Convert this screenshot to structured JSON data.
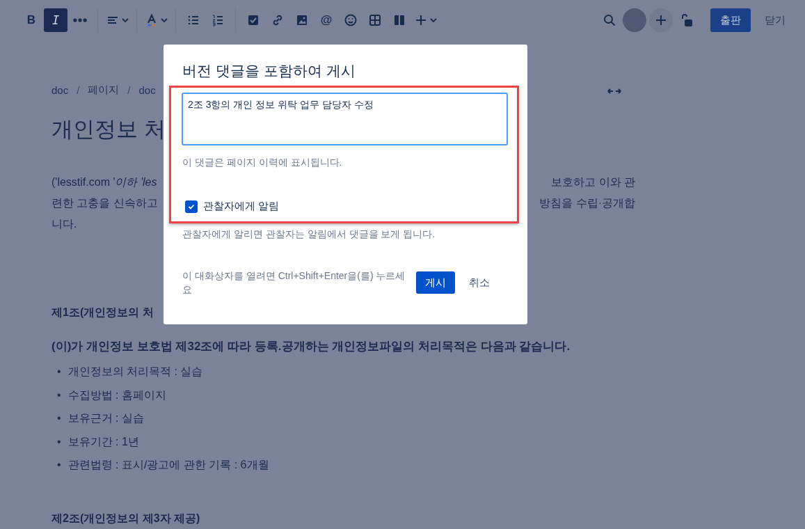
{
  "toolbar": {
    "groups": [
      {
        "items": [
          {
            "kind": "bold",
            "label": "B",
            "selected": false,
            "dropdown": false
          },
          {
            "kind": "italic",
            "label": "I",
            "selected": true,
            "dropdown": false
          },
          {
            "kind": "more",
            "selected": false,
            "dropdown": false
          }
        ]
      },
      {
        "items": [
          {
            "kind": "align",
            "selected": false,
            "dropdown": true
          }
        ]
      },
      {
        "items": [
          {
            "kind": "text-color",
            "selected": false,
            "dropdown": true
          }
        ]
      },
      {
        "items": [
          {
            "kind": "bullet-list",
            "selected": false,
            "dropdown": false
          },
          {
            "kind": "numbered-list",
            "selected": false,
            "dropdown": false
          }
        ]
      },
      {
        "items": [
          {
            "kind": "task",
            "selected": false,
            "dropdown": false
          },
          {
            "kind": "link",
            "selected": false,
            "dropdown": false
          },
          {
            "kind": "image",
            "selected": false,
            "dropdown": false
          },
          {
            "kind": "mention",
            "label": "@",
            "selected": false,
            "dropdown": false
          },
          {
            "kind": "emoji",
            "selected": false,
            "dropdown": false
          },
          {
            "kind": "table",
            "selected": false,
            "dropdown": false
          },
          {
            "kind": "layout",
            "selected": false,
            "dropdown": false
          },
          {
            "kind": "insert",
            "selected": false,
            "dropdown": true
          }
        ]
      }
    ],
    "publish_button": "출판",
    "close_button": "닫기"
  },
  "breadcrumbs": [
    {
      "kind": "link",
      "text": "doc"
    },
    {
      "kind": "separator",
      "text": "/"
    },
    {
      "kind": "link",
      "text": "페이지"
    },
    {
      "kind": "separator",
      "text": "/"
    },
    {
      "kind": "link",
      "text": "doc"
    }
  ],
  "page_title": "개인정보 처",
  "intro_lines": [
    {
      "left": "('lesstif.com '*이하 'les*",
      "right": "보호하고 이와 관"
    },
    {
      "left": "련한 고충을 신속하고",
      "right": "방침을 수립·공개합"
    },
    {
      "left": "니다."
    }
  ],
  "section_1_heading": "제1조(개인정보의 처",
  "section_1_text": "(이)가 개인정보 보호법 제32조에 따라 등록.공개하는 개인정보파일의 처리목적은 다음과 같습니다.",
  "section_1_list": [
    {
      "bullet": "•",
      "text": "개인정보의 처리목적 : 실습"
    },
    {
      "bullet": "•",
      "text": "수집방법 : 홈페이지"
    },
    {
      "bullet": "•",
      "text": "보유근거 : 실습"
    },
    {
      "bullet": "•",
      "text": "보유기간 : 1년"
    },
    {
      "bullet": "•",
      "text": "관련법령 : 표시/광고에 관한 기록 : 6개월"
    }
  ],
  "section_2_heading": "제2조(개인정보의 제3자 제공)",
  "dialog": {
    "title": "버전 댓글을 포함하여 게시",
    "comment_value": "2조 3항의 개인 정보 위탁 업무 담당자 수정",
    "comment_hint": "이 댓글은 페이지 이력에 표시됩니다.",
    "notify_label": "관찰자에게 알림",
    "notify_checked": true,
    "notify_description": "관찰자에게 알리면 관찰자는 알림에서 댓글을 보게 됩니다.",
    "shortcut_hint": "이 대화상자를 열려면 Ctrl+Shift+Enter을(를) 누르세요",
    "submit_button": "게시",
    "cancel_button": "취소"
  }
}
